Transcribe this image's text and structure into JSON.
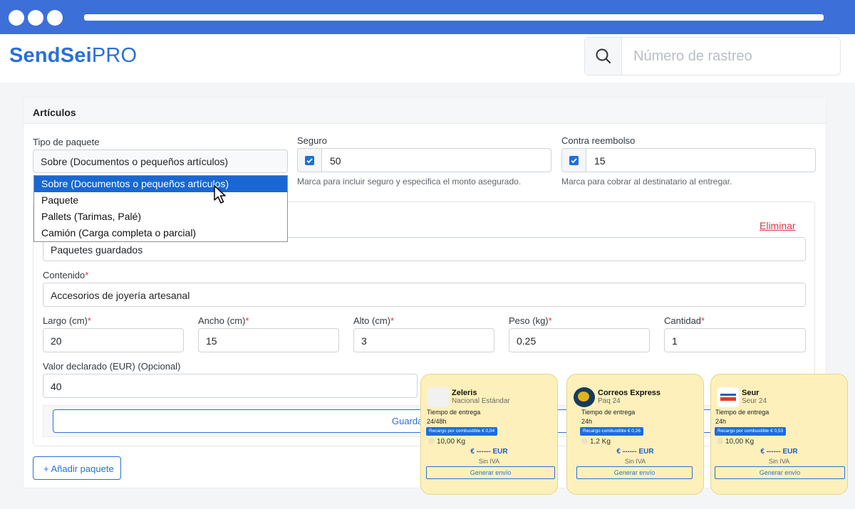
{
  "brand": {
    "name_bold": "SendSei",
    "name_light": "PRO"
  },
  "search": {
    "placeholder": "Número de rastreo"
  },
  "section": {
    "title": "Artículos"
  },
  "package_type": {
    "label": "Tipo de paquete",
    "selected": "Sobre (Documentos o pequeños artículos)",
    "options": [
      "Sobre (Documentos o pequeños artículos)",
      "Paquete",
      "Pallets (Tarimas, Palé)",
      "Camión (Carga completa o parcial)"
    ]
  },
  "insurance": {
    "label": "Seguro",
    "value": "50",
    "help": "Marca para incluir seguro y especifica el monto asegurado."
  },
  "cod": {
    "label": "Contra reembolso",
    "value": "15",
    "help": "Marca para cobrar al destinatario al entregar."
  },
  "package": {
    "delete_label": "Eliminar",
    "saved_value": "Paquetes guardados",
    "content_label": "Contenido",
    "content_value": "Accesorios de joyería artesanal",
    "dims": [
      {
        "label": "Largo (cm)",
        "value": "20"
      },
      {
        "label": "Ancho (cm)",
        "value": "15"
      },
      {
        "label": "Alto (cm)",
        "value": "3"
      },
      {
        "label": "Peso (kg)",
        "value": "0.25"
      },
      {
        "label": "Cantidad",
        "value": "1"
      }
    ],
    "required_mark": "*",
    "declared_label": "Valor declarado (EUR) (Opcional)",
    "declared_value": "40",
    "save_label": "Guardar"
  },
  "add_package_label": "+ Añadir paquete",
  "carriers": [
    {
      "name": "Zeleris",
      "service": "Nacional Estándar",
      "time_label": "Tiempo de entrega",
      "time": "24/48h",
      "surcharge": "Recargo por combustible € 0,04",
      "weight": "10,00 Kg",
      "price": "€ ------ EUR",
      "tax": "Sin IVA",
      "button": "Generar envío"
    },
    {
      "name": "Correos Express",
      "service": "Paq 24",
      "time_label": "Tiempo de entrega",
      "time": "24h",
      "surcharge": "Recargo combustible € 0,26",
      "weight": "1,2 Kg",
      "price": "€ ------ EUR",
      "tax": "Sin IVA",
      "button": "Generar envío"
    },
    {
      "name": "Seur",
      "service": "Seur 24",
      "time_label": "Tiempo de entrega",
      "time": "24h",
      "surcharge": "Recargo por combustible € 0,53",
      "weight": "10,00 Kg",
      "price": "€ ------ EUR",
      "tax": "Sin IVA",
      "button": "Generar envío"
    }
  ],
  "colors": {
    "brand": "#2a6fdb",
    "chrome": "#3d6fd8",
    "danger": "#dc3545",
    "card": "#fdf0bb",
    "highlight": "#1967d2"
  }
}
